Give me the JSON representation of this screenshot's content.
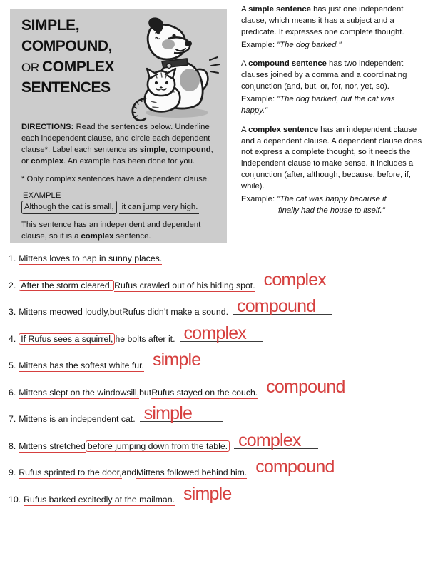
{
  "worksheet": {
    "title_lines": [
      "SIMPLE,",
      "COMPOUND,",
      "OR COMPLEX",
      "SENTENCES"
    ],
    "title_or_prefix": "OR ",
    "illustration_name": "dog-and-cat-illustration"
  },
  "directions": {
    "label": "DIRECTIONS:",
    "line1_a": " Read the sentences below. Underline each independent clause, and circle each dependent clause*. Label each sentence as ",
    "bold_simple": "simple",
    "sep1": ", ",
    "bold_compound": "compound",
    "sep2": ", or ",
    "bold_complex": "complex",
    "line1_b": ". An example has been done for you.",
    "footnote": "* Only complex sentences have a dependent clause.",
    "example_label": "EXAMPLE",
    "example_dependent": "Although the cat is small,",
    "example_independent": "it can jump very high.",
    "example_explain_a": "This sentence has an independent and dependent clause, so it is a ",
    "example_explain_bold": "complex",
    "example_explain_b": " sentence."
  },
  "definitions": [
    {
      "lead": "A ",
      "term": "simple sentence",
      "body": " has just one independent clause, which means it has a subject and a predicate. It expresses one complete thought.",
      "example_label": "Example: ",
      "example_text": "\"The dog barked.\"",
      "example_cont": ""
    },
    {
      "lead": "A ",
      "term": "compound sentence",
      "body": " has two independent clauses joined by a comma and a coordinating conjunction (and, but, or, for, nor, yet, so).",
      "example_label": "Example: ",
      "example_text": "\"The dog barked, but the cat was happy.\"",
      "example_cont": ""
    },
    {
      "lead": "A ",
      "term": "complex sentence",
      "body": " has an independent clause and a dependent clause. A dependent clause does not express a complete thought, so it needs the independent clause to make sense. It includes a conjunction (after, although, because, before, if, while).",
      "example_label": "Example: ",
      "example_text": "\"The cat was happy because it",
      "example_cont": "finally had the house to itself.\""
    }
  ],
  "questions": [
    {
      "number": "1.",
      "parts": [
        {
          "kind": "independent",
          "text": "Mittens loves to nap in sunny places."
        }
      ],
      "answer": "",
      "answer_width": 130
    },
    {
      "number": "2.",
      "parts": [
        {
          "kind": "dependent",
          "text": "After the storm cleared,"
        },
        {
          "kind": "independent",
          "text": "Rufus crawled out of his hiding spot."
        }
      ],
      "answer": "complex",
      "answer_width": 113
    },
    {
      "number": "3.",
      "parts": [
        {
          "kind": "independent",
          "text": "Mittens meowed loudly,"
        },
        {
          "kind": "plain",
          "text": " but "
        },
        {
          "kind": "independent",
          "text": "Rufus didn’t make a sound."
        }
      ],
      "answer": "compound",
      "answer_width": 140
    },
    {
      "number": "4.",
      "parts": [
        {
          "kind": "dependent",
          "text": "If Rufus sees a squirrel,"
        },
        {
          "kind": "independent",
          "text": "he bolts after it."
        }
      ],
      "answer": "complex",
      "answer_width": 116
    },
    {
      "number": "5.",
      "parts": [
        {
          "kind": "independent",
          "text": "Mittens has the softest white fur."
        }
      ],
      "answer": "simple",
      "answer_width": 116
    },
    {
      "number": "6.",
      "parts": [
        {
          "kind": "independent",
          "text": "Mittens slept on the windowsill,"
        },
        {
          "kind": "plain",
          "text": " but "
        },
        {
          "kind": "independent",
          "text": "Rufus stayed on the couch."
        }
      ],
      "answer": "compound",
      "answer_width": 142
    },
    {
      "number": "7.",
      "parts": [
        {
          "kind": "independent",
          "text": "Mittens is an independent cat."
        }
      ],
      "answer": "simple",
      "answer_width": 116
    },
    {
      "number": "8.",
      "parts": [
        {
          "kind": "independent",
          "text": "Mittens stretched"
        },
        {
          "kind": "dependent",
          "text": "before jumping down from the table."
        }
      ],
      "answer": "complex",
      "answer_width": 118
    },
    {
      "number": "9.",
      "parts": [
        {
          "kind": "independent",
          "text": "Rufus sprinted to the door,"
        },
        {
          "kind": "plain",
          "text": " and "
        },
        {
          "kind": "independent",
          "text": "Mittens followed behind him."
        }
      ],
      "answer": "compound",
      "answer_width": 142
    },
    {
      "number": "10.",
      "parts": [
        {
          "kind": "independent",
          "text": "Rufus barked excitedly at the mailman."
        }
      ],
      "answer": "simple",
      "answer_width": 120
    }
  ],
  "colors": {
    "panel_gray": "#cccccc",
    "annotation_red": "#d6403f",
    "text_black": "#141414",
    "rule_gray": "#3c3c3c"
  }
}
